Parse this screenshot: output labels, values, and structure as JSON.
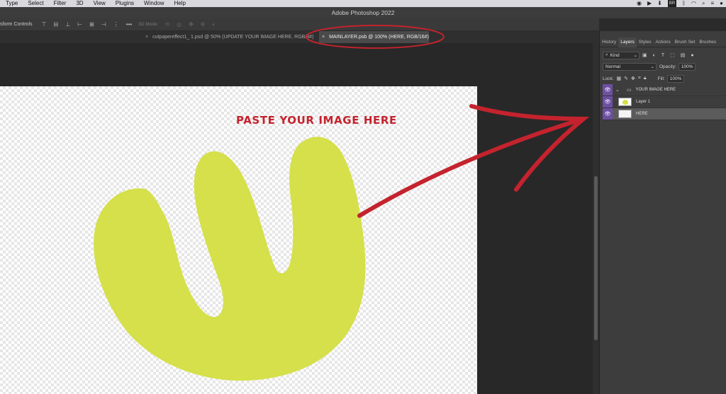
{
  "menubar": {
    "items": [
      "Type",
      "Select",
      "Filter",
      "3D",
      "View",
      "Plugins",
      "Window",
      "Help"
    ],
    "tray": [
      "BR"
    ]
  },
  "app": {
    "title": "Adobe Photoshop 2022"
  },
  "options_bar": {
    "transform_label": "sform Controls",
    "mode_label": "3D Mode:"
  },
  "tabs": [
    {
      "label": "cutpapereffect1_ 1.psd @ 50% (UPDATE YOUR IMAGE HERE, RGB/8#)",
      "active": false
    },
    {
      "label": "MAINLAYER.psb @ 100% (HERE, RGB/16#)",
      "active": true
    }
  ],
  "canvas": {
    "instruction_text": "PASTE YOUR IMAGE HERE",
    "accent_red": "#c4232e",
    "shape_color": "#d5e04a"
  },
  "panel": {
    "tabs": [
      "History",
      "Layers",
      "Styles",
      "Actions",
      "Brush Set",
      "Brushes"
    ],
    "active_tab": "Layers",
    "filter_kind": "Kind",
    "blend_mode": "Normal",
    "opacity_label": "Opacity:",
    "opacity_value": "100%",
    "lock_label": "Lock:",
    "fill_label": "Fill:",
    "fill_value": "100%",
    "layers": [
      {
        "name": "YOUR IMAGE HERE",
        "type": "group"
      },
      {
        "name": "Layer 1",
        "type": "layer"
      },
      {
        "name": "HERE",
        "type": "layer",
        "selected": true
      }
    ]
  }
}
